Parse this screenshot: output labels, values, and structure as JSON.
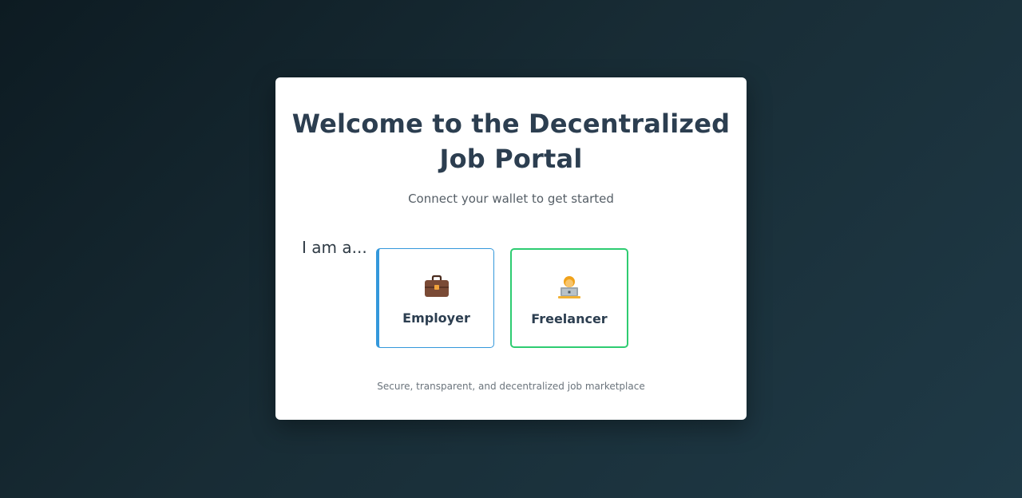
{
  "welcome": {
    "title": "Welcome to the Decentralized Job Portal",
    "subtitle": "Connect your wallet to get started",
    "role_prompt": "I am a...",
    "roles": [
      {
        "label": "Employer",
        "icon": "briefcase-icon",
        "accent_color": "#3498db"
      },
      {
        "label": "Freelancer",
        "icon": "technologist-icon",
        "accent_color": "#2ecc71"
      }
    ],
    "footer": "Secure, transparent, and decentralized job marketplace"
  },
  "colors": {
    "heading": "#2c3e50",
    "card_background": "#ffffff",
    "page_background": "#182c35"
  }
}
